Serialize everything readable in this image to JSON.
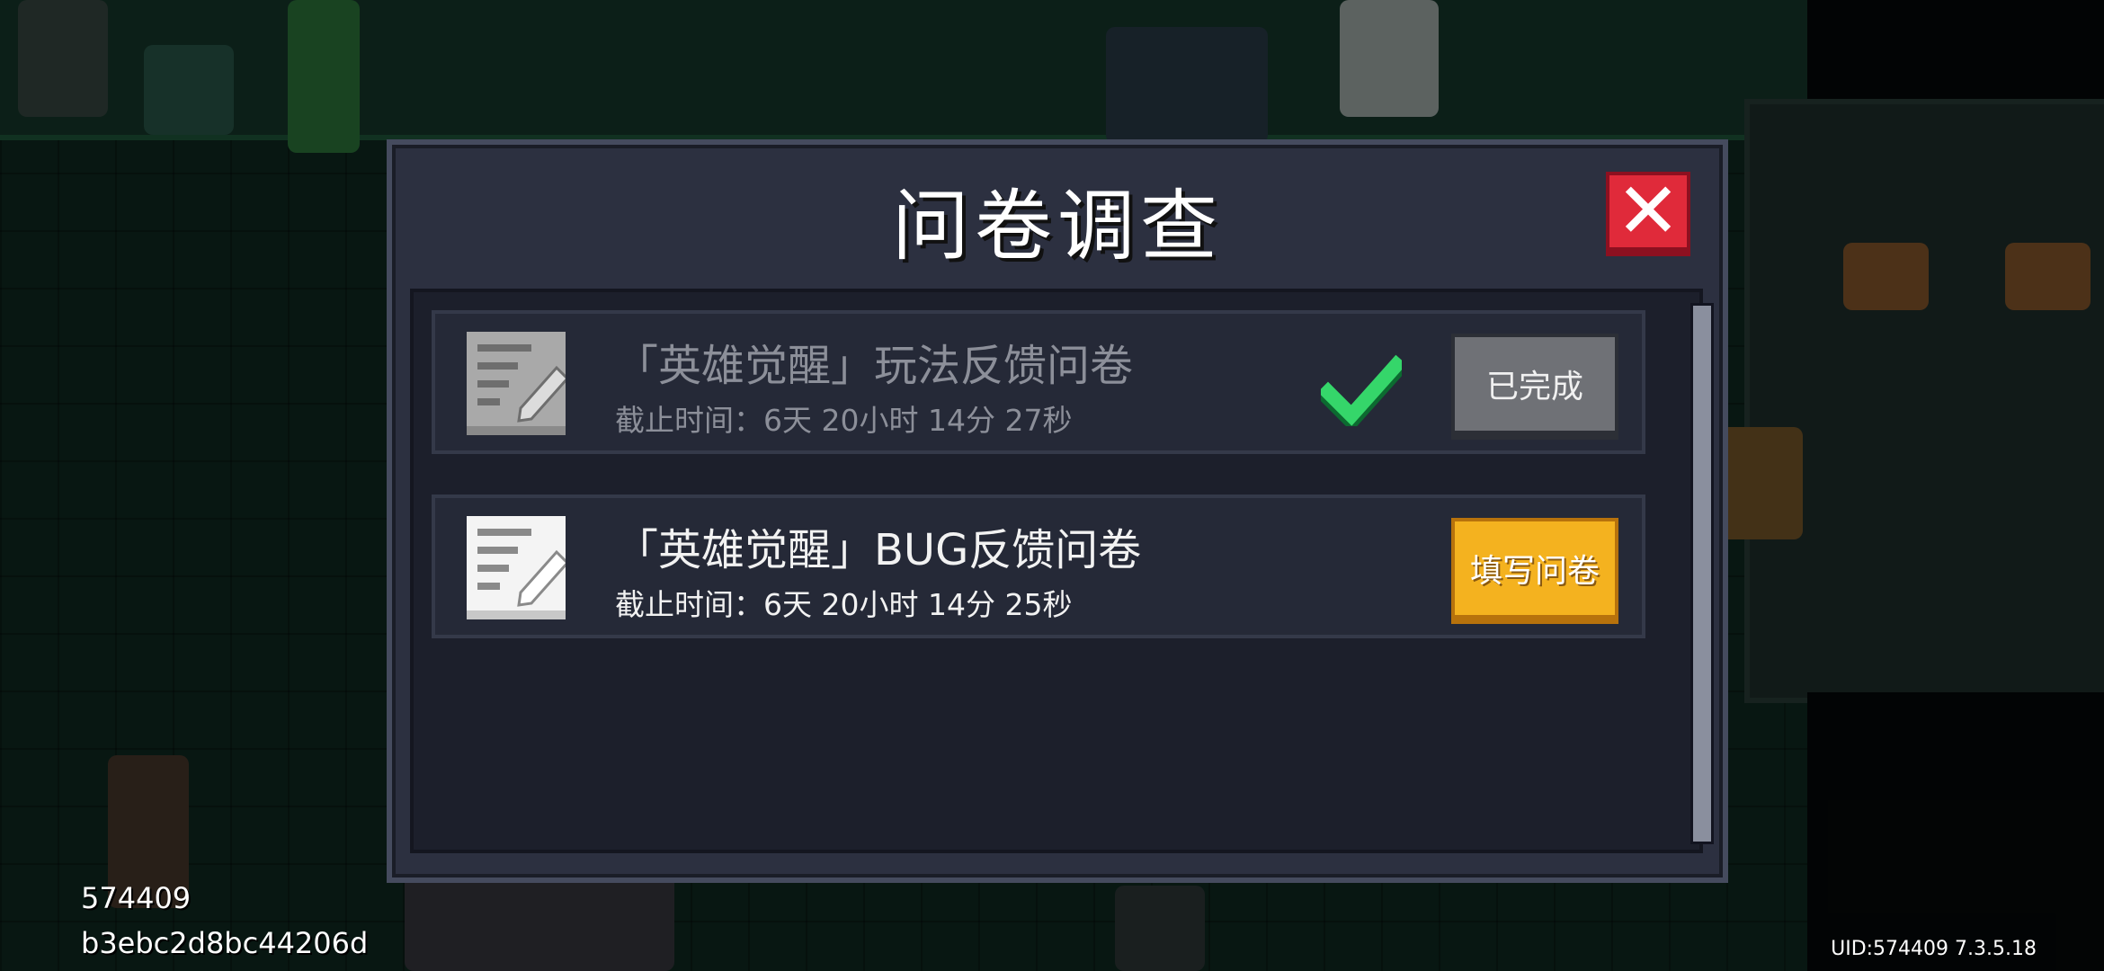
{
  "dialog": {
    "title": "问卷调查",
    "close_icon": "close-icon"
  },
  "surveys": [
    {
      "name": "「英雄觉醒」玩法反馈问卷",
      "deadline": "截止时间：6天 20小时 14分 27秒",
      "status": "completed",
      "button_label": "已完成"
    },
    {
      "name": "「英雄觉醒」BUG反馈问卷",
      "deadline": "截止时间：6天 20小时 14分 25秒",
      "status": "open",
      "button_label": "填写问卷"
    }
  ],
  "hud": {
    "player_id": "574409",
    "device_hash": "b3ebc2d8bc44206d",
    "uid_version": "UID:574409 7.3.5.18"
  },
  "colors": {
    "accent_yellow": "#f4b21f",
    "close_red": "#e02a3a",
    "check_green": "#35d66a"
  }
}
